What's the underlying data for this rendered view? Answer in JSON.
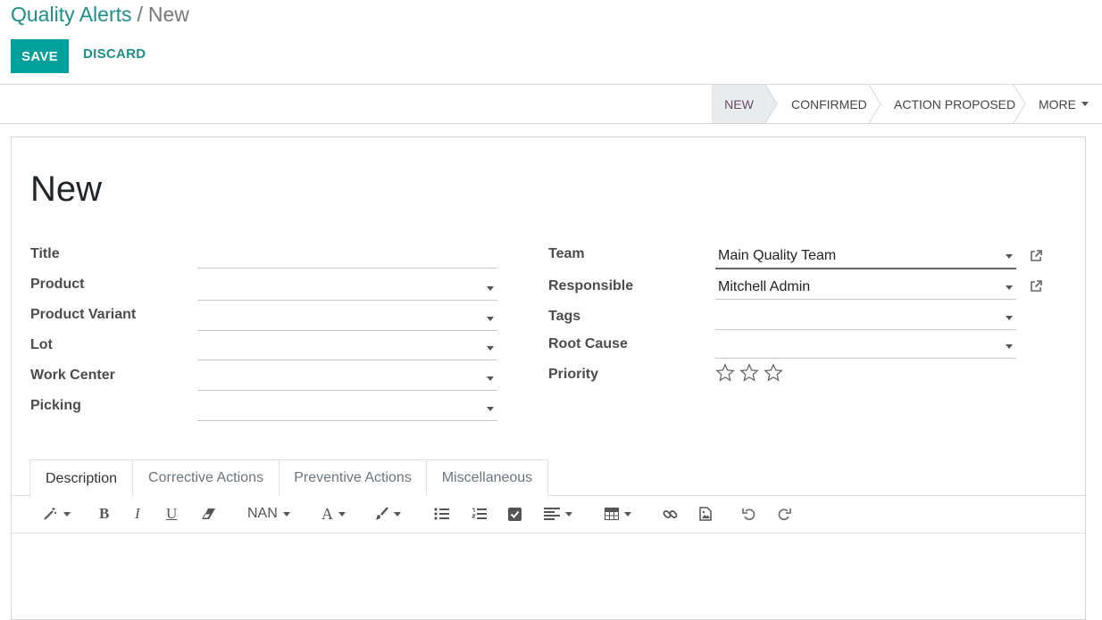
{
  "breadcrumb": {
    "parent": "Quality Alerts",
    "separator": "/",
    "current": "New"
  },
  "buttons": {
    "save": "SAVE",
    "discard": "DISCARD"
  },
  "statusbar": {
    "stages": [
      "NEW",
      "CONFIRMED",
      "ACTION PROPOSED"
    ],
    "current": "NEW",
    "more": "MORE"
  },
  "record": {
    "title": "New"
  },
  "form": {
    "left": [
      {
        "label": "Title",
        "value": "",
        "has_dropdown": false
      },
      {
        "label": "Product",
        "value": "",
        "has_dropdown": true
      },
      {
        "label": "Product Variant",
        "value": "",
        "has_dropdown": true
      },
      {
        "label": "Lot",
        "value": "",
        "has_dropdown": true
      },
      {
        "label": "Work Center",
        "value": "",
        "has_dropdown": true
      },
      {
        "label": "Picking",
        "value": "",
        "has_dropdown": true
      }
    ],
    "right": [
      {
        "label": "Team",
        "value": "Main Quality Team"
      },
      {
        "label": "Responsible",
        "value": "Mitchell Admin"
      },
      {
        "label": "Tags",
        "value": ""
      },
      {
        "label": "Root Cause",
        "value": ""
      },
      {
        "label": "Priority",
        "stars": 0,
        "max_stars": 3
      }
    ]
  },
  "tabs": [
    "Description",
    "Corrective Actions",
    "Preventive Actions",
    "Miscellaneous"
  ],
  "active_tab": "Description",
  "editor_toolbar": {
    "font_size": "NAN",
    "icons": [
      "magic-wand-icon",
      "bold-icon",
      "italic-icon",
      "underline-icon",
      "eraser-icon",
      "font-color-icon",
      "paint-brush-icon",
      "unordered-list-icon",
      "ordered-list-icon",
      "checklist-icon",
      "align-icon",
      "table-icon",
      "link-icon",
      "image-icon",
      "undo-icon",
      "redo-icon"
    ]
  },
  "colors": {
    "accent": "#00a09d",
    "link": "#1c8f8a",
    "status_current": "#6b4b60"
  }
}
